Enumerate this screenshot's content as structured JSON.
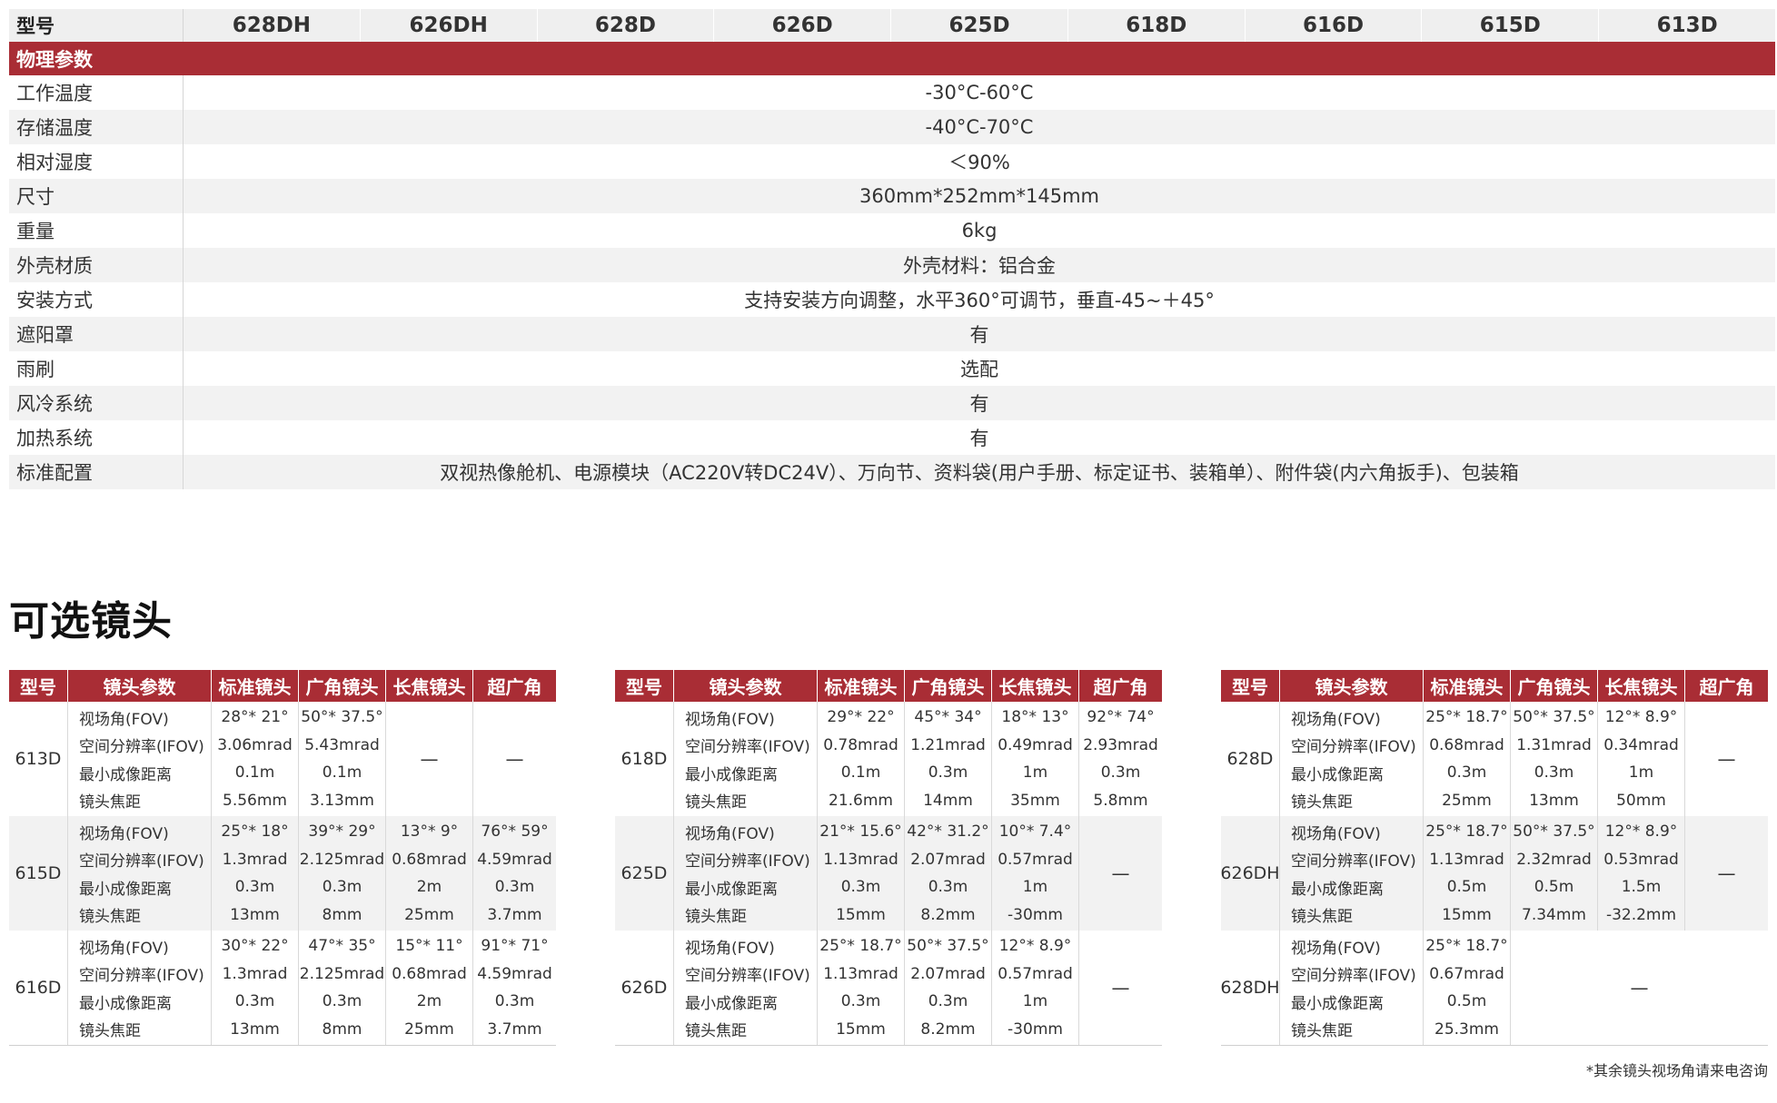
{
  "spec": {
    "header_label": "型号",
    "models": [
      "628DH",
      "626DH",
      "628D",
      "626D",
      "625D",
      "618D",
      "616D",
      "615D",
      "613D"
    ],
    "section_title": "物理参数",
    "rows": [
      {
        "label": "工作温度",
        "value": "-30°C-60°C"
      },
      {
        "label": "存储温度",
        "value": "-40°C-70°C"
      },
      {
        "label": "相对湿度",
        "value": "＜90%"
      },
      {
        "label": "尺寸",
        "value": "360mm*252mm*145mm"
      },
      {
        "label": "重量",
        "value": "6kg"
      },
      {
        "label": "外壳材质",
        "value": "外壳材料：铝合金"
      },
      {
        "label": "安装方式",
        "value": "支持安装方向调整，水平360°可调节，垂直-45~＋45°"
      },
      {
        "label": "遮阳罩",
        "value": "有"
      },
      {
        "label": "雨刷",
        "value": "选配"
      },
      {
        "label": "风冷系统",
        "value": "有"
      },
      {
        "label": "加热系统",
        "value": "有"
      },
      {
        "label": "标准配置",
        "value": "双视热像舱机、电源模块（AC220V转DC24V）、万向节、资料袋(用户手册、标定证书、装箱单）、附件袋(内六角扳手)、包装箱"
      }
    ]
  },
  "lens_title": "可选镜头",
  "lens_headers": [
    "型号",
    "镜头参数",
    "标准镜头",
    "广角镜头",
    "长焦镜头",
    "超广角"
  ],
  "lens_params": [
    "视场角(FOV)",
    "空间分辨率(IFOV)",
    "最小成像距离",
    "镜头焦距"
  ],
  "dash": "—",
  "lens_tables": [
    {
      "groups": [
        {
          "model": "613D",
          "cols": [
            [
              "28°* 21°",
              "3.06mrad",
              "0.1m",
              "5.56mm"
            ],
            [
              "50°* 37.5°",
              "5.43mrad",
              "0.1m",
              "3.13mm"
            ],
            null,
            null
          ]
        },
        {
          "model": "615D",
          "cols": [
            [
              "25°* 18°",
              "1.3mrad",
              "0.3m",
              "13mm"
            ],
            [
              "39°* 29°",
              "2.125mrad",
              "0.3m",
              "8mm"
            ],
            [
              "13°* 9°",
              "0.68mrad",
              "2m",
              "25mm"
            ],
            [
              "76°* 59°",
              "4.59mrad",
              "0.3m",
              "3.7mm"
            ]
          ]
        },
        {
          "model": "616D",
          "cols": [
            [
              "30°* 22°",
              "1.3mrad",
              "0.3m",
              "13mm"
            ],
            [
              "47°* 35°",
              "2.125mrad",
              "0.3m",
              "8mm"
            ],
            [
              "15°* 11°",
              "0.68mrad",
              "2m",
              "25mm"
            ],
            [
              "91°* 71°",
              "4.59mrad",
              "0.3m",
              "3.7mm"
            ]
          ]
        }
      ]
    },
    {
      "groups": [
        {
          "model": "618D",
          "cols": [
            [
              "29°* 22°",
              "0.78mrad",
              "0.1m",
              "21.6mm"
            ],
            [
              "45°* 34°",
              "1.21mrad",
              "0.3m",
              "14mm"
            ],
            [
              "18°* 13°",
              "0.49mrad",
              "1m",
              "35mm"
            ],
            [
              "92°* 74°",
              "2.93mrad",
              "0.3m",
              "5.8mm"
            ]
          ]
        },
        {
          "model": "625D",
          "cols": [
            [
              "21°* 15.6°",
              "1.13mrad",
              "0.3m",
              "15mm"
            ],
            [
              "42°* 31.2°",
              "2.07mrad",
              "0.3m",
              "8.2mm"
            ],
            [
              "10°* 7.4°",
              "0.57mrad",
              "1m",
              "-30mm"
            ],
            null
          ]
        },
        {
          "model": "626D",
          "cols": [
            [
              "25°* 18.7°",
              "1.13mrad",
              "0.3m",
              "15mm"
            ],
            [
              "50°* 37.5°",
              "2.07mrad",
              "0.3m",
              "8.2mm"
            ],
            [
              "12°* 8.9°",
              "0.57mrad",
              "1m",
              "-30mm"
            ],
            null
          ]
        }
      ]
    },
    {
      "groups": [
        {
          "model": "628D",
          "cols": [
            [
              "25°* 18.7°",
              "0.68mrad",
              "0.3m",
              "25mm"
            ],
            [
              "50°* 37.5°",
              "1.31mrad",
              "0.3m",
              "13mm"
            ],
            [
              "12°* 8.9°",
              "0.34mrad",
              "1m",
              "50mm"
            ],
            null
          ]
        },
        {
          "model": "626DH",
          "cols": [
            [
              "25°* 18.7°",
              "1.13mrad",
              "0.5m",
              "15mm"
            ],
            [
              "50°* 37.5°",
              "2.32mrad",
              "0.5m",
              "7.34mm"
            ],
            [
              "12°* 8.9°",
              "0.53mrad",
              "1.5m",
              "-32.2mm"
            ],
            null
          ]
        },
        {
          "model": "628DH",
          "cols": [
            [
              "25°* 18.7°",
              "0.67mrad",
              "0.5m",
              "25.3mm"
            ],
            "merged"
          ]
        }
      ]
    }
  ],
  "note": "*其余镜头视场角请来电咨询"
}
